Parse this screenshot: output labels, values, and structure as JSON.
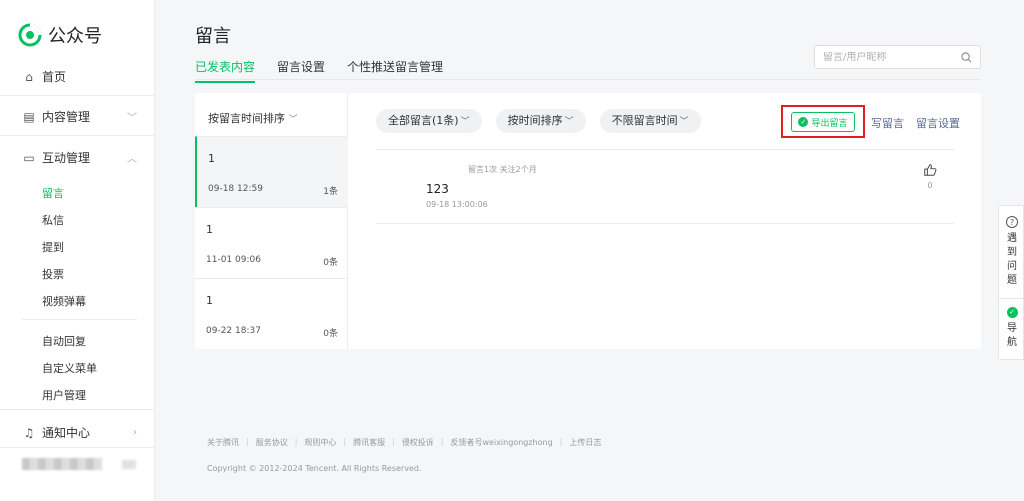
{
  "brand": {
    "name": "公众号",
    "color": "#07c160"
  },
  "sidebar": {
    "items": [
      {
        "label": "首页",
        "icon": "home-icon"
      },
      {
        "label": "内容管理",
        "icon": "document-icon"
      },
      {
        "label": "互动管理",
        "icon": "chat-icon"
      }
    ],
    "interaction_subitems": [
      "留言",
      "私信",
      "提到",
      "投票",
      "视频弹幕"
    ],
    "interaction_subitems_2": [
      "自动回复",
      "自定义菜单",
      "用户管理"
    ],
    "notification": {
      "label": "通知中心",
      "icon": "bell-icon"
    }
  },
  "page": {
    "title": "留言",
    "tabs": [
      "已发表内容",
      "留言设置",
      "个性推送留言管理"
    ],
    "search_placeholder": "留言/用户昵称"
  },
  "articles": {
    "sort_label": "按留言时间排序",
    "items": [
      {
        "title": "1",
        "date": "09-18 12:59",
        "count": "1条"
      },
      {
        "title": "1",
        "date": "11-01 09:06",
        "count": "0条"
      },
      {
        "title": "1",
        "date": "09-22 18:37",
        "count": "0条"
      }
    ]
  },
  "filters": [
    "全部留言(1条)",
    "按时间排序",
    "不限留言时间"
  ],
  "actions": {
    "export": "导出留言",
    "write": "写留言",
    "settings": "留言设置"
  },
  "comment": {
    "meta": "留言1次 关注2个月",
    "text": "123",
    "date": "09-18 13:00:06",
    "likes": "0"
  },
  "footer": {
    "links": [
      "关于腾讯",
      "服务协议",
      "规则中心",
      "腾讯客服",
      "侵权投诉",
      "反馈者号weixingongzhong",
      "上传日志"
    ],
    "copyright": "Copyright © 2012-2024 Tencent. All Rights Reserved."
  },
  "help_widget": {
    "help_text": "遇到问题",
    "nav_text": "导航"
  }
}
